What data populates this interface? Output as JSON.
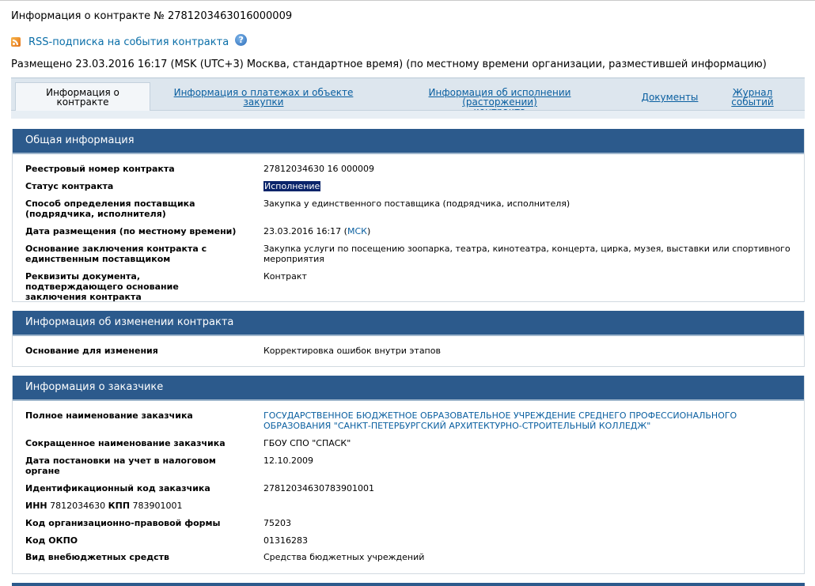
{
  "header": {
    "title": "Информация о контракте № 2781203463016000009",
    "rss_label": "RSS-подписка на события контракта",
    "published": "Размещено 23.03.2016 16:17 (MSK (UTC+3) Москва, стандартное время) (по местному времени организации, разместившей информацию)"
  },
  "tabs": {
    "info_line1": "Информация о",
    "info_line2": "контракте",
    "payments_line1": "Информация о платежах и объекте",
    "payments_line2": "закупки",
    "execution_line1": "Информация об исполнении (расторжении)",
    "execution_line2": "контракта",
    "documents": "Документы",
    "journal_line1": "Журнал",
    "journal_line2": "событий"
  },
  "general": {
    "title": "Общая информация",
    "reg_number_label": "Реестровый номер контракта",
    "reg_number_value": "27812034630 16 000009",
    "status_label": "Статус контракта",
    "status_value": "Исполнение",
    "method_label": "Способ определения поставщика (подрядчика, исполнителя)",
    "method_value": "Закупка у единственного поставщика (подрядчика, исполнителя)",
    "date_label": "Дата размещения (по местному времени)",
    "date_value": "23.03.2016 16:17 (",
    "date_tz": "МСК",
    "date_close": ")",
    "basis_label": "Основание заключения контракта с единственным поставщиком",
    "basis_value": "Закупка услуги по посещению зоопарка, театра, кинотеатра, концерта, цирка, музея, выставки или спортивного мероприятия",
    "requisites_label": "Реквизиты документа, подтверждающего основание заключения контракта",
    "requisites_value": "Контракт"
  },
  "change": {
    "title": "Информация об изменении контракта",
    "reason_label": "Основание для изменения",
    "reason_value": "Корректировка ошибок внутри этапов"
  },
  "customer": {
    "title": "Информация о заказчике",
    "full_name_label": "Полное наименование заказчика",
    "full_name_value": "ГОСУДАРСТВЕННОЕ БЮДЖЕТНОЕ ОБРАЗОВАТЕЛЬНОЕ УЧРЕЖДЕНИЕ СРЕДНЕГО ПРОФЕССИОНАЛЬНОГО ОБРАЗОВАНИЯ \"САНКТ-ПЕТЕРБУРГСКИЙ АРХИТЕКТУРНО-СТРОИТЕЛЬНЫЙ КОЛЛЕДЖ\"",
    "short_name_label": "Сокращенное наименование заказчика",
    "short_name_value": "ГБОУ СПО \"СПАСК\"",
    "tax_date_label": "Дата постановки на учет в налоговом органе",
    "tax_date_value": "12.10.2009",
    "id_code_label": "Идентификационный код заказчика",
    "id_code_value": "27812034630783901001",
    "inn_label": "ИНН",
    "inn_value": "7812034630",
    "kpp_label": "КПП",
    "kpp_value": "783901001",
    "okopf_label": "Код организационно-правовой формы",
    "okopf_value": "75203",
    "okpo_label": "Код ОКПО",
    "okpo_value": "01316283",
    "funds_label": "Вид внебюджетных средств",
    "funds_value": "Средства бюджетных учреждений"
  }
}
